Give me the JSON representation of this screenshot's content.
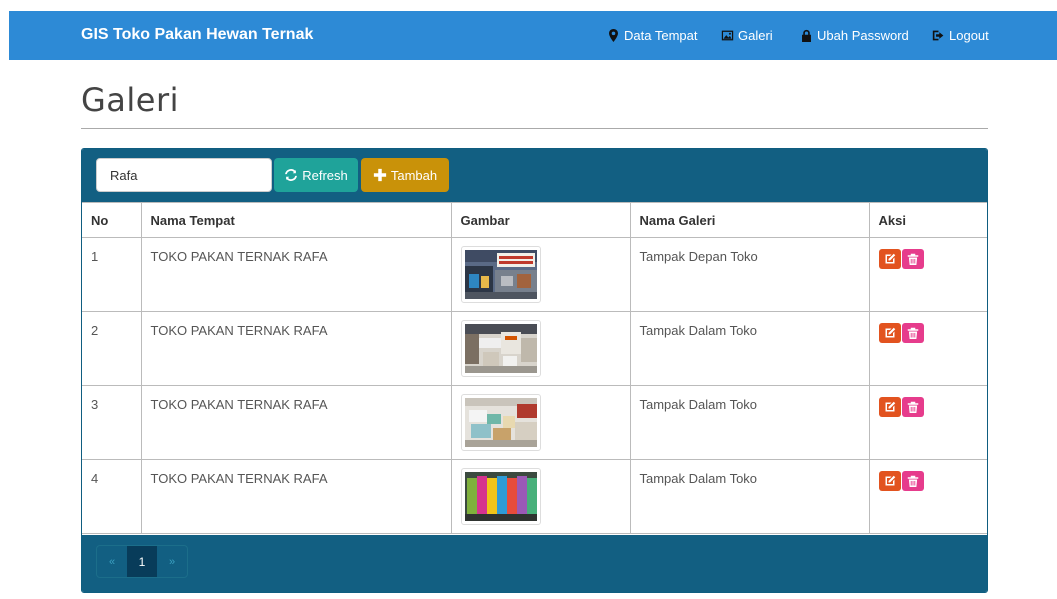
{
  "navbar": {
    "brand": "GIS Toko Pakan Hewan Ternak",
    "items": [
      {
        "label": "Data Tempat",
        "icon": "map-marker-icon"
      },
      {
        "label": "Galeri",
        "icon": "picture-icon"
      },
      {
        "label": "Ubah Password",
        "icon": "lock-icon"
      },
      {
        "label": "Logout",
        "icon": "logout-icon"
      }
    ]
  },
  "page": {
    "title": "Galeri"
  },
  "toolbar": {
    "search_value": "Rafa",
    "refresh_label": "Refresh",
    "add_label": "Tambah"
  },
  "table": {
    "headers": [
      "No",
      "Nama Tempat",
      "Gambar",
      "Nama Galeri",
      "Aksi"
    ],
    "rows": [
      {
        "no": "1",
        "nama_tempat": "TOKO PAKAN TERNAK RAFA",
        "nama_galeri": "Tampak Depan Toko"
      },
      {
        "no": "2",
        "nama_tempat": "TOKO PAKAN TERNAK RAFA",
        "nama_galeri": "Tampak Dalam Toko"
      },
      {
        "no": "3",
        "nama_tempat": "TOKO PAKAN TERNAK RAFA",
        "nama_galeri": "Tampak Dalam Toko"
      },
      {
        "no": "4",
        "nama_tempat": "TOKO PAKAN TERNAK RAFA",
        "nama_galeri": "Tampak Dalam Toko"
      }
    ]
  },
  "pagination": {
    "prev": "«",
    "current": "1",
    "next": "»"
  },
  "colors": {
    "navbar": "#2d8ad6",
    "panel": "#125f82",
    "refresh": "#1fa39a",
    "add": "#c99209",
    "edit": "#e2531f",
    "delete": "#e63c8c"
  }
}
